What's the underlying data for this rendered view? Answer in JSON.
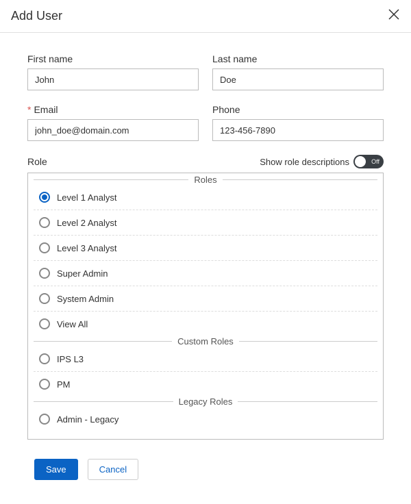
{
  "header": {
    "title": "Add User"
  },
  "fields": {
    "first_name": {
      "label": "First name",
      "value": "John"
    },
    "last_name": {
      "label": "Last name",
      "value": "Doe"
    },
    "email": {
      "label": "Email",
      "value": "john_doe@domain.com"
    },
    "phone": {
      "label": "Phone",
      "value": "123-456-7890"
    }
  },
  "role_section": {
    "label": "Role",
    "toggle_label": "Show role descriptions",
    "toggle_state": "Off",
    "groups": {
      "roles": {
        "legend": "Roles",
        "items": [
          "Level 1 Analyst",
          "Level 2 Analyst",
          "Level 3 Analyst",
          "Super Admin",
          "System Admin",
          "View All"
        ],
        "selected": "Level 1 Analyst"
      },
      "custom": {
        "legend": "Custom Roles",
        "items": [
          "IPS L3",
          "PM"
        ]
      },
      "legacy": {
        "legend": "Legacy Roles",
        "items": [
          "Admin - Legacy"
        ]
      }
    }
  },
  "footer": {
    "save": "Save",
    "cancel": "Cancel"
  }
}
